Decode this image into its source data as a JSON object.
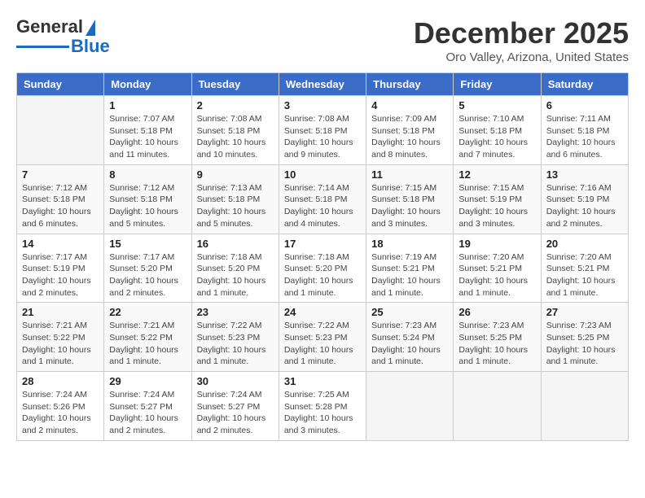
{
  "logo": {
    "line1": "General",
    "line2": "Blue"
  },
  "title": "December 2025",
  "location": "Oro Valley, Arizona, United States",
  "days_of_week": [
    "Sunday",
    "Monday",
    "Tuesday",
    "Wednesday",
    "Thursday",
    "Friday",
    "Saturday"
  ],
  "weeks": [
    [
      {
        "num": "",
        "info": ""
      },
      {
        "num": "1",
        "info": "Sunrise: 7:07 AM\nSunset: 5:18 PM\nDaylight: 10 hours\nand 11 minutes."
      },
      {
        "num": "2",
        "info": "Sunrise: 7:08 AM\nSunset: 5:18 PM\nDaylight: 10 hours\nand 10 minutes."
      },
      {
        "num": "3",
        "info": "Sunrise: 7:08 AM\nSunset: 5:18 PM\nDaylight: 10 hours\nand 9 minutes."
      },
      {
        "num": "4",
        "info": "Sunrise: 7:09 AM\nSunset: 5:18 PM\nDaylight: 10 hours\nand 8 minutes."
      },
      {
        "num": "5",
        "info": "Sunrise: 7:10 AM\nSunset: 5:18 PM\nDaylight: 10 hours\nand 7 minutes."
      },
      {
        "num": "6",
        "info": "Sunrise: 7:11 AM\nSunset: 5:18 PM\nDaylight: 10 hours\nand 6 minutes."
      }
    ],
    [
      {
        "num": "7",
        "info": "Sunrise: 7:12 AM\nSunset: 5:18 PM\nDaylight: 10 hours\nand 6 minutes."
      },
      {
        "num": "8",
        "info": "Sunrise: 7:12 AM\nSunset: 5:18 PM\nDaylight: 10 hours\nand 5 minutes."
      },
      {
        "num": "9",
        "info": "Sunrise: 7:13 AM\nSunset: 5:18 PM\nDaylight: 10 hours\nand 5 minutes."
      },
      {
        "num": "10",
        "info": "Sunrise: 7:14 AM\nSunset: 5:18 PM\nDaylight: 10 hours\nand 4 minutes."
      },
      {
        "num": "11",
        "info": "Sunrise: 7:15 AM\nSunset: 5:18 PM\nDaylight: 10 hours\nand 3 minutes."
      },
      {
        "num": "12",
        "info": "Sunrise: 7:15 AM\nSunset: 5:19 PM\nDaylight: 10 hours\nand 3 minutes."
      },
      {
        "num": "13",
        "info": "Sunrise: 7:16 AM\nSunset: 5:19 PM\nDaylight: 10 hours\nand 2 minutes."
      }
    ],
    [
      {
        "num": "14",
        "info": "Sunrise: 7:17 AM\nSunset: 5:19 PM\nDaylight: 10 hours\nand 2 minutes."
      },
      {
        "num": "15",
        "info": "Sunrise: 7:17 AM\nSunset: 5:20 PM\nDaylight: 10 hours\nand 2 minutes."
      },
      {
        "num": "16",
        "info": "Sunrise: 7:18 AM\nSunset: 5:20 PM\nDaylight: 10 hours\nand 1 minute."
      },
      {
        "num": "17",
        "info": "Sunrise: 7:18 AM\nSunset: 5:20 PM\nDaylight: 10 hours\nand 1 minute."
      },
      {
        "num": "18",
        "info": "Sunrise: 7:19 AM\nSunset: 5:21 PM\nDaylight: 10 hours\nand 1 minute."
      },
      {
        "num": "19",
        "info": "Sunrise: 7:20 AM\nSunset: 5:21 PM\nDaylight: 10 hours\nand 1 minute."
      },
      {
        "num": "20",
        "info": "Sunrise: 7:20 AM\nSunset: 5:21 PM\nDaylight: 10 hours\nand 1 minute."
      }
    ],
    [
      {
        "num": "21",
        "info": "Sunrise: 7:21 AM\nSunset: 5:22 PM\nDaylight: 10 hours\nand 1 minute."
      },
      {
        "num": "22",
        "info": "Sunrise: 7:21 AM\nSunset: 5:22 PM\nDaylight: 10 hours\nand 1 minute."
      },
      {
        "num": "23",
        "info": "Sunrise: 7:22 AM\nSunset: 5:23 PM\nDaylight: 10 hours\nand 1 minute."
      },
      {
        "num": "24",
        "info": "Sunrise: 7:22 AM\nSunset: 5:23 PM\nDaylight: 10 hours\nand 1 minute."
      },
      {
        "num": "25",
        "info": "Sunrise: 7:23 AM\nSunset: 5:24 PM\nDaylight: 10 hours\nand 1 minute."
      },
      {
        "num": "26",
        "info": "Sunrise: 7:23 AM\nSunset: 5:25 PM\nDaylight: 10 hours\nand 1 minute."
      },
      {
        "num": "27",
        "info": "Sunrise: 7:23 AM\nSunset: 5:25 PM\nDaylight: 10 hours\nand 1 minute."
      }
    ],
    [
      {
        "num": "28",
        "info": "Sunrise: 7:24 AM\nSunset: 5:26 PM\nDaylight: 10 hours\nand 2 minutes."
      },
      {
        "num": "29",
        "info": "Sunrise: 7:24 AM\nSunset: 5:27 PM\nDaylight: 10 hours\nand 2 minutes."
      },
      {
        "num": "30",
        "info": "Sunrise: 7:24 AM\nSunset: 5:27 PM\nDaylight: 10 hours\nand 2 minutes."
      },
      {
        "num": "31",
        "info": "Sunrise: 7:25 AM\nSunset: 5:28 PM\nDaylight: 10 hours\nand 3 minutes."
      },
      {
        "num": "",
        "info": ""
      },
      {
        "num": "",
        "info": ""
      },
      {
        "num": "",
        "info": ""
      }
    ]
  ]
}
